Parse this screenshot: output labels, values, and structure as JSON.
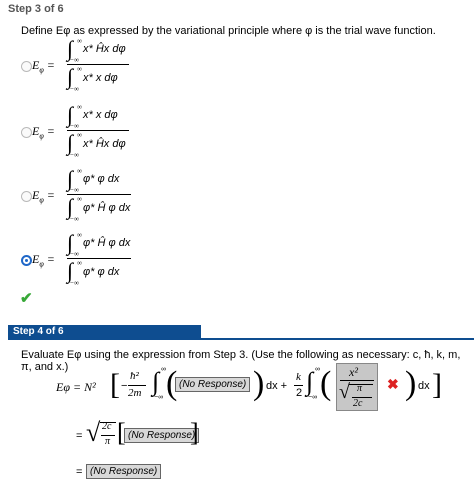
{
  "step3": {
    "title": "Step 3 of 6",
    "question": "Define Eφ as expressed by the variational principle where φ is the trial wave function.",
    "options": [
      {
        "lhs": "E",
        "sub": "φ",
        "eq": "=",
        "num": "x* Ĥx dφ",
        "den": "x* x dφ",
        "upper": "∞",
        "lower": "−∞",
        "selected": false
      },
      {
        "lhs": "E",
        "sub": "φ",
        "eq": "=",
        "num": "x* x dφ",
        "den": "x* Ĥx dφ",
        "upper": "∞",
        "lower": "−∞",
        "selected": false
      },
      {
        "lhs": "E",
        "sub": "φ",
        "eq": "=",
        "num": "φ* φ dx",
        "den": "φ* Ĥ φ dx",
        "upper": "∞",
        "lower": "−∞",
        "selected": false
      },
      {
        "lhs": "E",
        "sub": "φ",
        "eq": "=",
        "num": "φ* Ĥ φ dx",
        "den": "φ* φ dx",
        "upper": "∞",
        "lower": "−∞",
        "selected": true
      }
    ],
    "correct_mark": "✔"
  },
  "step4": {
    "title": "Step 4 of 6",
    "prompt": "Evaluate Eφ using the expression from Step 3. (Use the following as necessary: c, ħ, k, m, π, and x.)",
    "line1": {
      "lhs": "Eφ = N²",
      "minus": "−",
      "hbar_num": "ħ²",
      "hbar_den": "2m",
      "upper": "∞",
      "lower": "−∞",
      "response": "(No Response)",
      "dx_plus": "dx +",
      "k_num": "k",
      "k_den": "2",
      "x2": "x²",
      "pi": "π",
      "two_c": "2c",
      "wrong_mark": "✖",
      "dx": "dx"
    },
    "line2": {
      "eq": "=",
      "num": "2c",
      "den": "π",
      "response": "(No Response)"
    },
    "line3": {
      "eq": "=",
      "response": "(No Response)"
    }
  }
}
